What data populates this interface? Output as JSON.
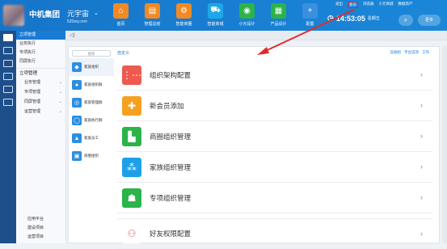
{
  "brand": {
    "name": "中机集团",
    "sub": "元宇宙",
    "url": "520eq.com"
  },
  "apps": [
    {
      "label": "首页",
      "icon": "home-icon",
      "color": "#f08a24",
      "glyph": "⌂"
    },
    {
      "label": "管理总结",
      "icon": "briefcase-icon",
      "color": "#f08a24",
      "glyph": "▤"
    },
    {
      "label": "智能商圈",
      "icon": "gear-icon",
      "color": "#f08a24",
      "glyph": "⚙"
    },
    {
      "label": "智能商城",
      "icon": "cart-icon",
      "color": "#1ea7e8",
      "glyph": "⛟"
    },
    {
      "label": "小元设计",
      "icon": "globe-icon",
      "color": "#2cb34a",
      "glyph": "◉"
    },
    {
      "label": "产品设计",
      "icon": "grid-icon",
      "color": "#2cb34a",
      "glyph": "▦"
    },
    {
      "label": "配置",
      "icon": "plus-icon",
      "color": "#3a8fe0",
      "glyph": "+"
    }
  ],
  "toplinks": [
    "退出",
    "会员",
    "浏览器",
    "小元商城",
    "数据资产"
  ],
  "clock": {
    "time": "14:53:05",
    "weekday": "星期五"
  },
  "header_buttons": {
    "more": "更多"
  },
  "sidebar": {
    "top_items": [
      {
        "label": "立项管理",
        "active": true
      },
      {
        "label": "业务执行",
        "active": false
      },
      {
        "label": "专项执行",
        "active": false
      },
      {
        "label": "同屏执行",
        "active": false
      }
    ],
    "section": "立项管理",
    "sub_items": [
      "业务管理",
      "专项管理",
      "同屏管理",
      "运营管理"
    ],
    "bottom_items": [
      "应用平台",
      "建设项目",
      "运营项目"
    ]
  },
  "panel": {
    "search_placeholder": "搜索",
    "title": "自定义",
    "actions": [
      "压缩组",
      "平台选项",
      "工作"
    ],
    "groups": [
      {
        "label": "家族组织",
        "glyph": "◆"
      },
      {
        "label": "家族组织群",
        "glyph": "●"
      },
      {
        "label": "家族管理群",
        "glyph": "◎"
      },
      {
        "label": "家族执行群",
        "glyph": "◯"
      },
      {
        "label": "家族员工",
        "glyph": "▲"
      },
      {
        "label": "商圈组织",
        "glyph": "▣"
      }
    ],
    "rows": [
      {
        "label": "组织架构配置",
        "icon": "org-chart-icon",
        "color": "#ee5a4f",
        "glyph": "⋮⋯"
      },
      {
        "label": "新会员添加",
        "icon": "add-member-icon",
        "color": "#f5a11f",
        "glyph": "✚"
      },
      {
        "label": "商圈组织管理",
        "icon": "business-org-icon",
        "color": "#2cb34a",
        "glyph": "▙"
      },
      {
        "label": "家族组织管理",
        "icon": "family-org-icon",
        "color": "#1ea0e8",
        "glyph": "⁂"
      },
      {
        "label": "专项组织管理",
        "icon": "project-org-icon",
        "color": "#2cb34a",
        "glyph": "☗"
      },
      {
        "label": "好友权限配置",
        "icon": "friend-permission-icon",
        "color": "#ffffff",
        "glyph": "⚇"
      }
    ]
  }
}
